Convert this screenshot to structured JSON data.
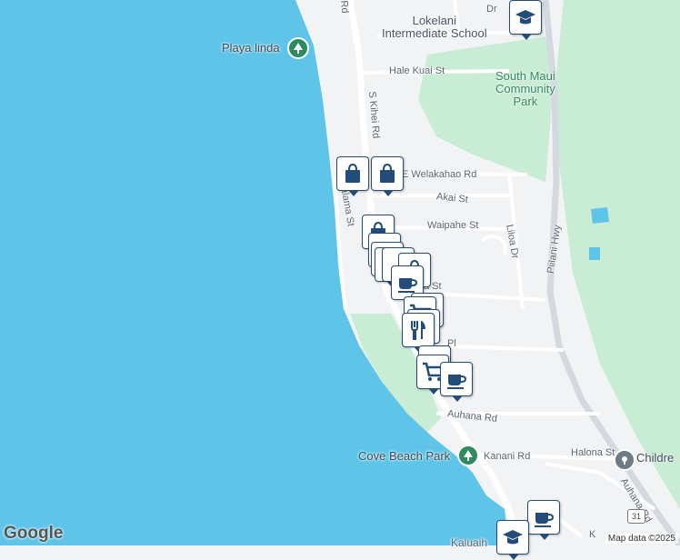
{
  "map": {
    "water_color": "#5ec4e8",
    "land_color": "#f2f3f5",
    "park_color": "#c8ecd4",
    "road_color": "#ffffff",
    "highway_color": "#d4d9df"
  },
  "streets": {
    "s_kihei_rd": "S Kihei Rd",
    "hale_kuai": "Hale Kuai St",
    "welakahao": "E Welakahao Rd",
    "akai": "Akai St",
    "waipahe": "Waipahe St",
    "liloa": "Liloa Dr",
    "kalama": "Kalama St",
    "piilani": "Piilani Hwy",
    "auhana": "Auhana Rd",
    "kanani": "Kanani Rd",
    "halona": "Halona St",
    "kanani_s": "Auhana Rd",
    "ki": "Ki",
    "a_st": "a St",
    "pl": "Pl",
    "dr_top": "Dr",
    "rd_top": "Rd",
    "kaluaih": "Kaluaih",
    "k_bottom": "K"
  },
  "places": {
    "playa_linda": "Playa linda",
    "lokelani": "Lokelani\nIntermediate School",
    "south_maui_park": "South Maui\nCommunity\nPark",
    "cove_beach_park": "Cove Beach Park",
    "children": "Childre"
  },
  "highway_shield": "31",
  "footer": {
    "logo": "Google",
    "attribution": "Map data ©2025"
  },
  "icons": {
    "shopping": "shopping-bag-icon",
    "cafe": "coffee-cup-icon",
    "restaurant": "fork-knife-icon",
    "grocery": "shopping-cart-icon",
    "school": "school-cap-icon",
    "park": "tree-icon"
  }
}
